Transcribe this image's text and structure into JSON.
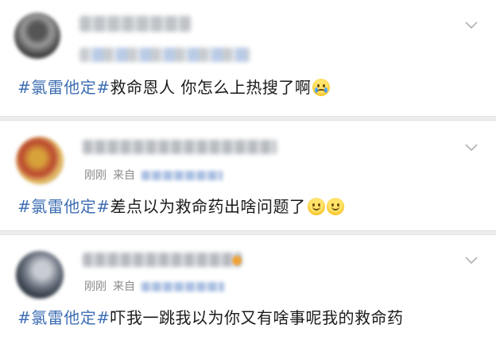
{
  "posts": [
    {
      "hashtag": "#氯雷他定#",
      "text": "救命恩人 你怎么上热搜了啊",
      "emojis": [
        "crying-face"
      ]
    },
    {
      "time": "刚刚",
      "source_prefix": "来自",
      "hashtag": "#氯雷他定#",
      "text": "差点以为救命药出啥问题了",
      "emojis": [
        "smiling-face",
        "smiling-face"
      ]
    },
    {
      "time": "刚刚",
      "source_prefix": "来自",
      "hashtag": "#氯雷他定#",
      "text": "吓我一跳我以为你又有啥事呢我的救命药",
      "emojis": []
    }
  ],
  "colors": {
    "hashtag": "#3f6fb4",
    "meta_text": "#8a8a8a",
    "separator": "#ededed"
  },
  "icons": {
    "menu": "chevron-down-icon"
  }
}
